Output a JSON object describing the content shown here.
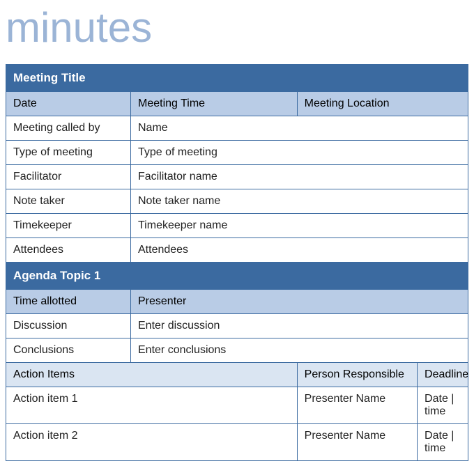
{
  "title": "minutes",
  "meeting": {
    "section_title": "Meeting Title",
    "date_label": "Date",
    "time_label": "Meeting Time",
    "location_label": "Meeting Location",
    "rows": [
      {
        "label": "Meeting called by",
        "value": "Name"
      },
      {
        "label": "Type of meeting",
        "value": "Type of meeting"
      },
      {
        "label": "Facilitator",
        "value": "Facilitator name"
      },
      {
        "label": "Note taker",
        "value": "Note taker name"
      },
      {
        "label": "Timekeeper",
        "value": "Timekeeper name"
      },
      {
        "label": "Attendees",
        "value": "Attendees"
      }
    ]
  },
  "agenda": {
    "section_title": "Agenda Topic 1",
    "time_allotted_label": "Time allotted",
    "presenter_label": "Presenter",
    "discussion_label": "Discussion",
    "discussion_value": "Enter discussion",
    "conclusions_label": "Conclusions",
    "conclusions_value": "Enter conclusions",
    "action_items_label": "Action Items",
    "person_responsible_label": "Person Responsible",
    "deadline_label": "Deadline",
    "items": [
      {
        "name": "Action item 1",
        "person": "Presenter Name",
        "deadline": "Date | time"
      },
      {
        "name": "Action item 2",
        "person": "Presenter Name",
        "deadline": "Date | time"
      }
    ]
  }
}
